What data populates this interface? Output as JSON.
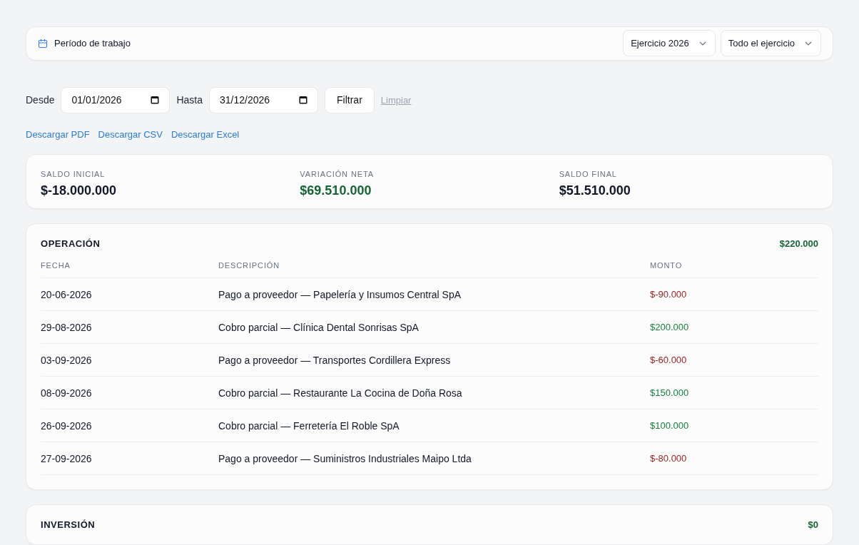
{
  "period": {
    "label": "Período de trabajo",
    "selects": [
      "Ejercicio 2026",
      "Todo el ejercicio"
    ]
  },
  "filter": {
    "from_label": "Desde",
    "from": "01/01/2026",
    "to_label": "Hasta",
    "to": "31/12/2026",
    "apply": "Filtrar",
    "clear": "Limpiar"
  },
  "downloads": [
    "Descargar PDF",
    "Descargar CSV",
    "Descargar Excel"
  ],
  "summary": [
    {
      "label": "SALDO INICIAL",
      "value": "$-18.000.000",
      "kind": "neutral"
    },
    {
      "label": "VARIACIÓN NETA",
      "value": "$69.510.000",
      "kind": "positive"
    },
    {
      "label": "SALDO FINAL",
      "value": "$51.510.000",
      "kind": "neutral"
    }
  ],
  "sections": [
    {
      "title": "OPERACIÓN",
      "total": "$220.000",
      "columns": [
        "FECHA",
        "DESCRIPCIÓN",
        "MONTO"
      ],
      "rows": [
        {
          "date": "20-06-2026",
          "description": "Pago a proveedor — Papelería y Insumos Central SpA",
          "amount": "$-90.000",
          "color": "#991b1b"
        },
        {
          "date": "29-08-2026",
          "description": "Cobro parcial — Clínica Dental Sonrisas SpA",
          "amount": "$200.000",
          "color": "#15803d"
        },
        {
          "date": "03-09-2026",
          "description": "Pago a proveedor — Transportes Cordillera Express",
          "amount": "$-60.000",
          "color": "#991b1b"
        },
        {
          "date": "08-09-2026",
          "description": "Cobro parcial — Restaurante La Cocina de Doña Rosa",
          "amount": "$150.000",
          "color": "#15803d"
        },
        {
          "date": "26-09-2026",
          "description": "Cobro parcial — Ferretería El Roble SpA",
          "amount": "$100.000",
          "color": "#15803d"
        },
        {
          "date": "27-09-2026",
          "description": "Pago a proveedor — Suministros Industriales Maipo Ltda",
          "amount": "$-80.000",
          "color": "#991b1b"
        }
      ]
    },
    {
      "title": "INVERSIÓN",
      "total": "$0"
    }
  ]
}
